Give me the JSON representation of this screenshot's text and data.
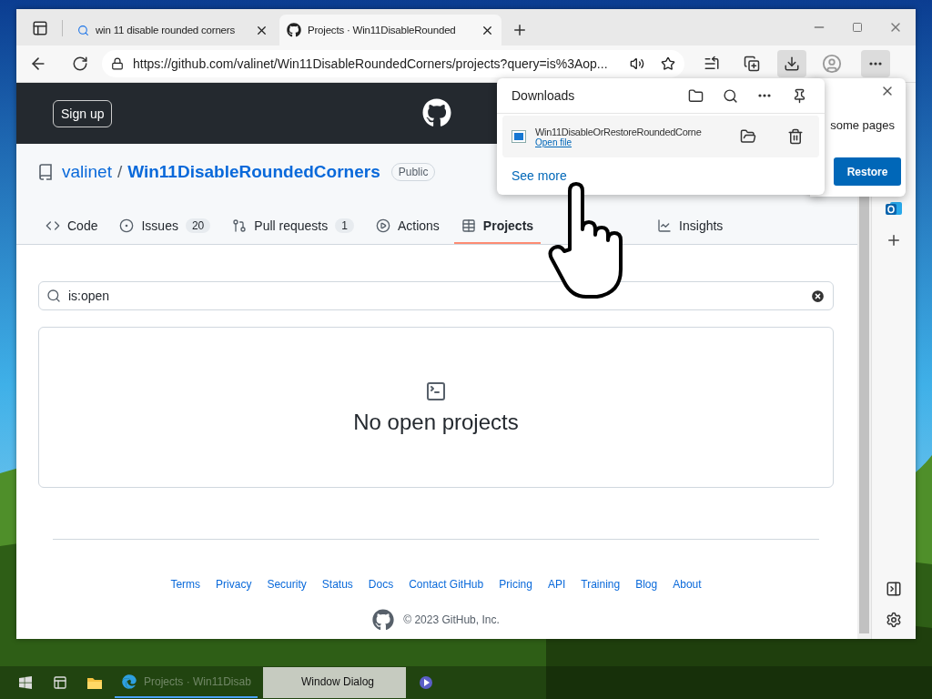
{
  "browser": {
    "tabs": [
      {
        "kind": "search",
        "title": "win 11 disable rounded corners",
        "selected": false
      },
      {
        "kind": "github",
        "title": "Projects · Win11DisableRounded",
        "selected": true
      }
    ],
    "url": "https://github.com/valinet/Win11DisableRoundedCorners/projects?query=is%3Aop..."
  },
  "downloads": {
    "title": "Downloads",
    "items": [
      {
        "filename": "Win11DisableOrRestoreRoundedCorne",
        "action": "Open file"
      }
    ],
    "see_more": "See more"
  },
  "notification": {
    "text": "some pages",
    "button": "Restore"
  },
  "github": {
    "signup": "Sign up",
    "owner": "valinet",
    "separator": "/",
    "repo": "Win11DisableRoundedCorners",
    "visibility": "Public",
    "nav": [
      {
        "kind": "code",
        "label": "Code",
        "selected": false
      },
      {
        "kind": "issues",
        "label": "Issues",
        "count": "20",
        "selected": false
      },
      {
        "kind": "pulls",
        "label": "Pull requests",
        "count": "1",
        "selected": false
      },
      {
        "kind": "actions",
        "label": "Actions",
        "selected": false
      },
      {
        "kind": "projects",
        "label": "Projects",
        "selected": true
      },
      {
        "kind": "insights",
        "label": "Insights",
        "selected": false
      }
    ],
    "search": {
      "value": "is:open"
    },
    "empty_state": "No open projects",
    "footer_links": [
      "Terms",
      "Privacy",
      "Security",
      "Status",
      "Docs",
      "Contact GitHub",
      "Pricing",
      "API",
      "Training",
      "Blog",
      "About"
    ],
    "copyright": "© 2023 GitHub, Inc."
  },
  "taskbar": {
    "items": [
      {
        "kind": "edge",
        "label": "Projects · Win11Disab",
        "selected": false
      },
      {
        "kind": "window",
        "label": "Window Dialog",
        "selected": true
      }
    ]
  }
}
